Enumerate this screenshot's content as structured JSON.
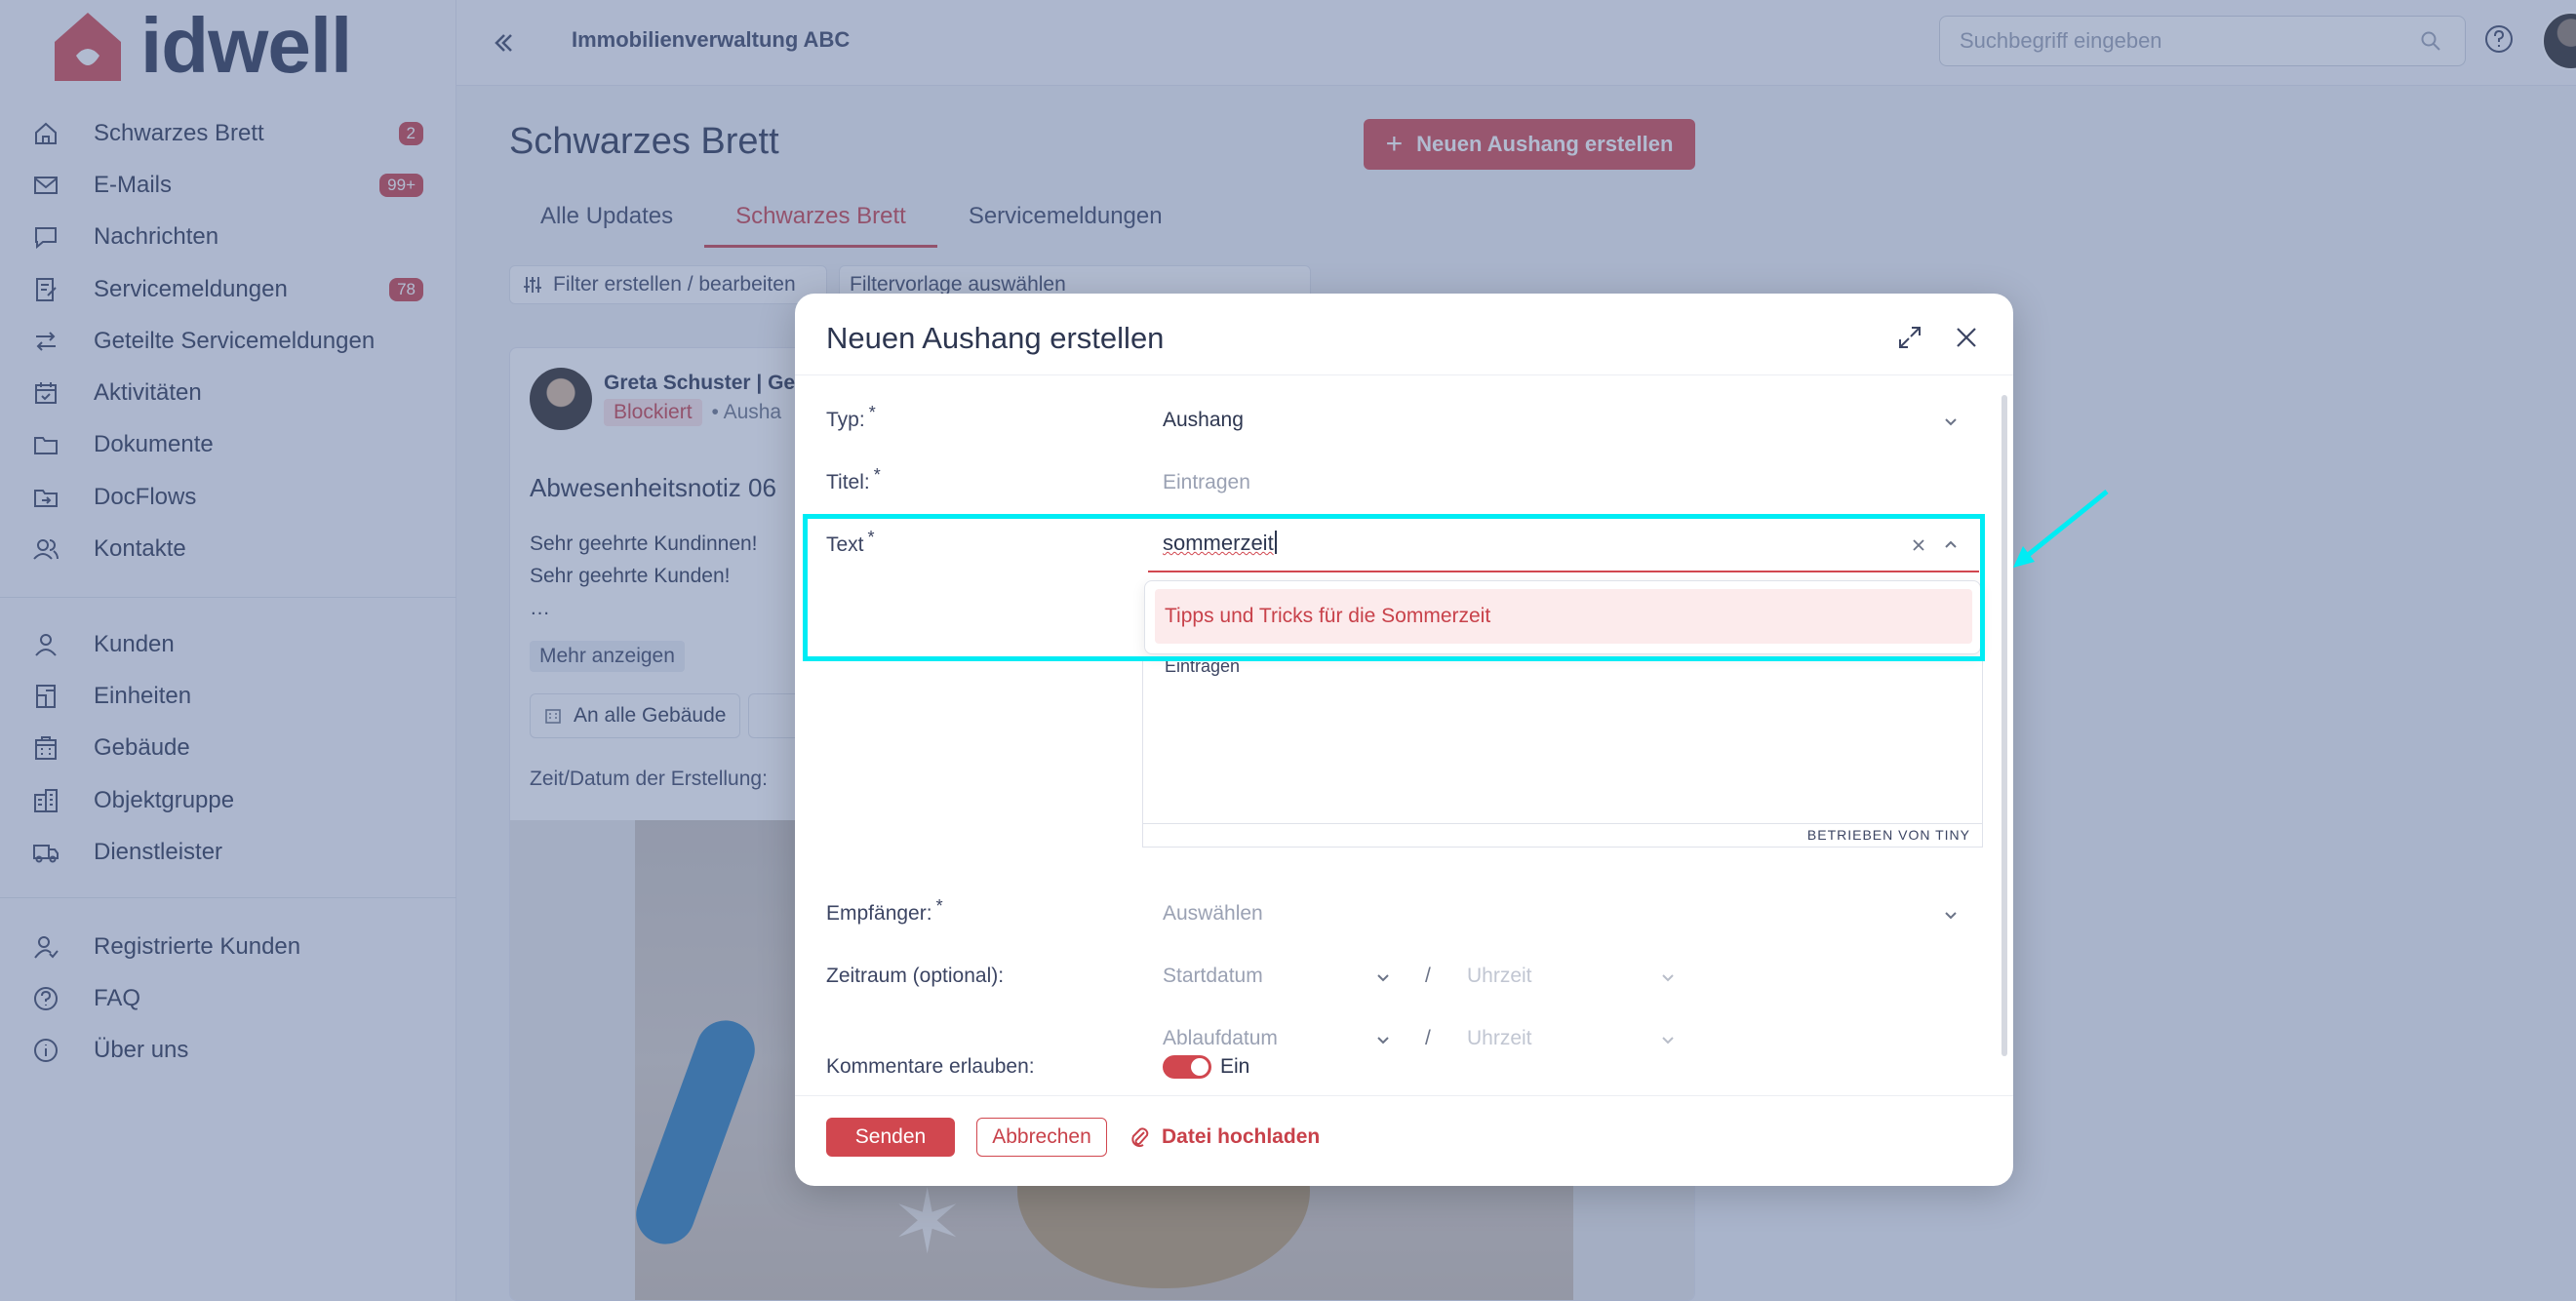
{
  "app": {
    "logo_text": "idwell",
    "company": "Immobilienverwaltung ABC"
  },
  "search": {
    "placeholder": "Suchbegriff eingeben"
  },
  "sidebar": {
    "items": [
      {
        "label": "Schwarzes Brett",
        "badge": "2"
      },
      {
        "label": "E-Mails",
        "badge": "99+"
      },
      {
        "label": "Nachrichten",
        "badge": ""
      },
      {
        "label": "Servicemeldungen",
        "badge": "78"
      },
      {
        "label": "Geteilte Servicemeldungen",
        "badge": ""
      },
      {
        "label": "Aktivitäten",
        "badge": ""
      },
      {
        "label": "Dokumente",
        "badge": ""
      },
      {
        "label": "DocFlows",
        "badge": ""
      },
      {
        "label": "Kontakte",
        "badge": ""
      },
      {
        "label": "Kunden",
        "badge": ""
      },
      {
        "label": "Einheiten",
        "badge": ""
      },
      {
        "label": "Gebäude",
        "badge": ""
      },
      {
        "label": "Objektgruppe",
        "badge": ""
      },
      {
        "label": "Dienstleister",
        "badge": ""
      },
      {
        "label": "Registrierte Kunden",
        "badge": ""
      },
      {
        "label": "FAQ",
        "badge": ""
      },
      {
        "label": "Über uns",
        "badge": ""
      }
    ]
  },
  "main": {
    "title": "Schwarzes Brett",
    "new_post_label": "Neuen Aushang erstellen",
    "tabs": [
      "Alle Updates",
      "Schwarzes Brett",
      "Servicemeldungen"
    ],
    "filter_label": "Filter erstellen / bearbeiten",
    "filter_preset": "Filtervorlage auswählen",
    "post": {
      "author": "Greta Schuster | Ge",
      "status": "Blockiert",
      "kind": "Ausha",
      "title": "Abwesenheitsnotiz 06",
      "body_line1": "Sehr geehrte Kundinnen!",
      "body_line2": "Sehr geehrte Kunden!",
      "body_ellipsis": "…",
      "more_label": "Mehr anzeigen",
      "audience": "An alle Gebäude",
      "date_label": "Zeit/Datum der Erstellung:"
    }
  },
  "modal": {
    "title": "Neuen Aushang erstellen",
    "type_label": "Typ:",
    "type_value": "Aushang",
    "title_label": "Titel:",
    "title_placeholder": "Eintragen",
    "text_label": "Text",
    "text_value": "sommerzeit",
    "suggestion": "Tipps und Tricks für die Sommerzeit",
    "editor_placeholder": "Eintragen",
    "editor_powered": "BETRIEBEN VON TINY",
    "recipient_label": "Empfänger:",
    "recipient_placeholder": "Auswählen",
    "period_label": "Zeitraum (optional):",
    "start_date": "Startdatum",
    "end_date": "Ablaufdatum",
    "time": "Uhrzeit",
    "slash": "/",
    "comments_label": "Kommentare erlauben:",
    "comments_value": "Ein",
    "required": "*",
    "send": "Senden",
    "cancel": "Abbrechen",
    "upload": "Datei hochladen"
  },
  "colors": {
    "accent": "#d1474f",
    "highlight": "#00ecf4",
    "text": "#2d3650"
  }
}
